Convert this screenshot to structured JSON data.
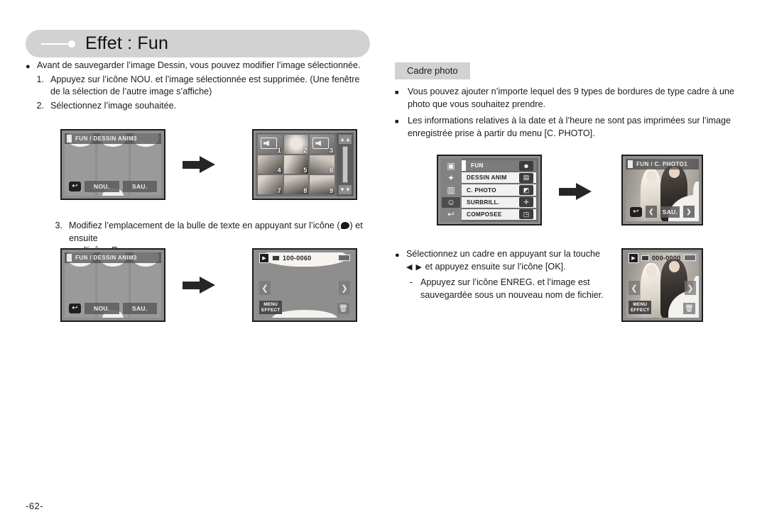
{
  "header": {
    "title": "Effet : Fun"
  },
  "page": {
    "number": "-62-"
  },
  "left_column": {
    "intro_bullet": "Avant de sauvegarder l’image Dessin, vous pouvez modifier l’image sélectionnée.",
    "steps": [
      {
        "num": "1.",
        "text": "Appuyez sur l’icône NOU. et l’image sélectionnée est supprimée.  (Une fenêtre",
        "cont": "de la sélection de l’autre image s’affiche)"
      },
      {
        "num": "2.",
        "text": "Sélectionnez l’image souhaitée.",
        "cont": ""
      }
    ],
    "step3": {
      "num": "3.",
      "text_before": "Modifiez l’emplacement de la bulle de texte en appuyant sur l’icône (",
      "text_after": ") et ensuite",
      "cont": "sur l’icône Reg."
    }
  },
  "right_column": {
    "section_chip": "Cadre photo",
    "bullets": [
      {
        "line1": "Vous pouvez ajouter n’importe lequel des 9 types de bordures de type cadre à une",
        "line2": "photo que vous souhaitez prendre."
      },
      {
        "line1": "Les informations relatives à la date et à l’heure ne sont pas imprimées sur l’image",
        "line2": "enregistrée prise à partir du menu [C. PHOTO]."
      }
    ],
    "select_bullet": {
      "line1": "Sélectionnez un cadre en appuyant sur la touche",
      "arrows": "◀ ▶",
      "line2_after": "et appuyez ensuite sur l’icône [OK].",
      "dash": "-",
      "dash_line1": "Appuyez sur l’icône ENREG. et l’image est",
      "dash_line2": "sauvegardée sous un nouveau nom de fichier."
    }
  },
  "screens": {
    "dessin_anim_1": {
      "title": "FUN / DESSIN ANIM3",
      "buttons": {
        "new": "NOU.",
        "save": "SAU."
      },
      "return_icon": "return-icon"
    },
    "thumbnail_grid": {
      "numbers": [
        "1",
        "2",
        "3",
        "4",
        "5",
        "6",
        "7",
        "8",
        "9"
      ],
      "up_icon": "chevron-up-icon",
      "down_icon": "chevron-down-icon"
    },
    "dessin_anim_2": {
      "title": "FUN / DESSIN ANIM3",
      "buttons": {
        "new": "NOU.",
        "save": "SAU."
      }
    },
    "playback_left": {
      "file_number": "100-0060",
      "menu_label_line1": "MENU",
      "menu_label_line2": "EFFECT",
      "play_icon": "play-icon",
      "trash_icon": "trash-icon",
      "prev_icon": "prev-arrow-icon",
      "next_icon": "next-arrow-icon"
    },
    "effect_menu": {
      "items": [
        {
          "label": "FUN",
          "left_icon": "frame-icon",
          "right_icon": "smiley-face-icon"
        },
        {
          "label": "DESSIN ANIM",
          "left_icon": "star-pen-icon",
          "right_icon": "picture-icon"
        },
        {
          "label": "C. PHOTO",
          "left_icon": "curtain-icon",
          "right_icon": "photo-frame-icon"
        },
        {
          "label": "SURBRILL.",
          "left_icon": "smiley-camera-icon",
          "right_icon": "highlight-icon"
        },
        {
          "label": "COMPOSEE",
          "left_icon": "return-icon",
          "right_icon": "composite-icon"
        }
      ]
    },
    "photo_frame": {
      "title": "FUN / C. PHOTO1",
      "save_button": "SAU.",
      "return_icon": "return-icon",
      "prev_icon": "prev-arrow-icon",
      "next_icon": "next-arrow-icon"
    },
    "playback_right": {
      "file_number": "000-0000",
      "menu_label_line1": "MENU",
      "menu_label_line2": "EFFECT",
      "play_icon": "play-icon",
      "trash_icon": "trash-icon"
    }
  }
}
